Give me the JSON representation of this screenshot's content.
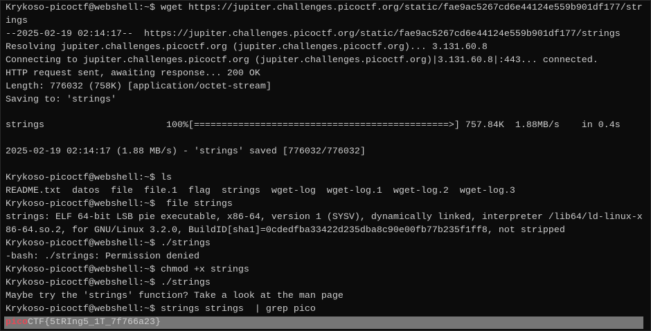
{
  "terminal": {
    "lines": [
      "Krykoso-picoctf@webshell:~$ wget https://jupiter.challenges.picoctf.org/static/fae9ac5267cd6e44124e559b901df177/str",
      "ings",
      "--2025-02-19 02:14:17--  https://jupiter.challenges.picoctf.org/static/fae9ac5267cd6e44124e559b901df177/strings",
      "Resolving jupiter.challenges.picoctf.org (jupiter.challenges.picoctf.org)... 3.131.60.8",
      "Connecting to jupiter.challenges.picoctf.org (jupiter.challenges.picoctf.org)|3.131.60.8|:443... connected.",
      "HTTP request sent, awaiting response... 200 OK",
      "Length: 776032 (758K) [application/octet-stream]",
      "Saving to: 'strings'",
      "",
      "strings                      100%[==============================================>] 757.84K  1.88MB/s    in 0.4s",
      "",
      "2025-02-19 02:14:17 (1.88 MB/s) - 'strings' saved [776032/776032]",
      "",
      "Krykoso-picoctf@webshell:~$ ls",
      "README.txt  datos  file  file.1  flag  strings  wget-log  wget-log.1  wget-log.2  wget-log.3",
      "Krykoso-picoctf@webshell:~$  file strings",
      "strings: ELF 64-bit LSB pie executable, x86-64, version 1 (SYSV), dynamically linked, interpreter /lib64/ld-linux-x",
      "86-64.so.2, for GNU/Linux 3.2.0, BuildID[sha1]=0cdedfba33422d235dba8c90e00fb77b235f1ff8, not stripped",
      "Krykoso-picoctf@webshell:~$ ./strings",
      "-bash: ./strings: Permission denied",
      "Krykoso-picoctf@webshell:~$ chmod +x strings",
      "Krykoso-picoctf@webshell:~$ ./strings",
      "Maybe try the 'strings' function? Take a look at the man page",
      "Krykoso-picoctf@webshell:~$ strings strings  | grep pico"
    ],
    "result": {
      "match": "pico",
      "rest": "CTF{5tRIng5_1T_7f766a23}"
    },
    "colors": {
      "background": "#0c0c0c",
      "text": "#cccccc",
      "match": "#e74856",
      "highlight": "#767676"
    }
  }
}
